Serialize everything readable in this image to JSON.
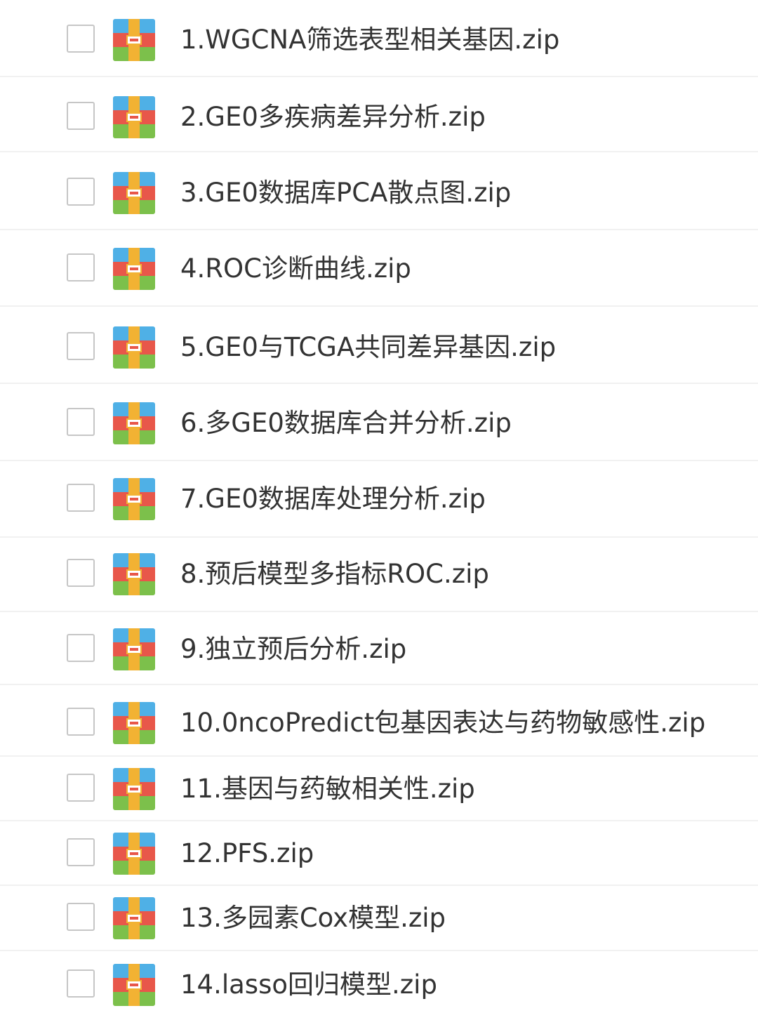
{
  "files": [
    {
      "name": "1.WGCNA筛选表型相关基因.zip",
      "icon": "zip-archive-icon",
      "checked": false
    },
    {
      "name": "2.GE0多疾病差异分析.zip",
      "icon": "zip-archive-icon",
      "checked": false
    },
    {
      "name": "3.GE0数据库PCA散点图.zip",
      "icon": "zip-archive-icon",
      "checked": false
    },
    {
      "name": "4.ROC诊断曲线.zip",
      "icon": "zip-archive-icon",
      "checked": false
    },
    {
      "name": "5.GE0与TCGA共同差异基因.zip",
      "icon": "zip-archive-icon",
      "checked": false
    },
    {
      "name": "6.多GE0数据库合并分析.zip",
      "icon": "zip-archive-icon",
      "checked": false
    },
    {
      "name": "7.GE0数据库处理分析.zip",
      "icon": "zip-archive-icon",
      "checked": false
    },
    {
      "name": "8.预后模型多指标ROC.zip",
      "icon": "zip-archive-icon",
      "checked": false
    },
    {
      "name": "9.独立预后分析.zip",
      "icon": "zip-archive-icon",
      "checked": false
    },
    {
      "name": "10.0ncoPredict包基因表达与药物敏感性.zip",
      "icon": "zip-archive-icon",
      "checked": false
    },
    {
      "name": "11.基因与药敏相关性.zip",
      "icon": "zip-archive-icon",
      "checked": false
    },
    {
      "name": "12.PFS.zip",
      "icon": "zip-archive-icon",
      "checked": false
    },
    {
      "name": "13.多园素Cox模型.zip",
      "icon": "zip-archive-icon",
      "checked": false
    },
    {
      "name": "14.lasso回归模型.zip",
      "icon": "zip-archive-icon",
      "checked": false
    }
  ],
  "colors": {
    "icon_top": "#4fb0e6",
    "icon_middle": "#e8574a",
    "icon_bottom": "#7cc04b",
    "icon_strap": "#f2b233",
    "text": "#333333",
    "checkbox_border": "#c6c6c6",
    "separator": "#f1f1f1"
  }
}
